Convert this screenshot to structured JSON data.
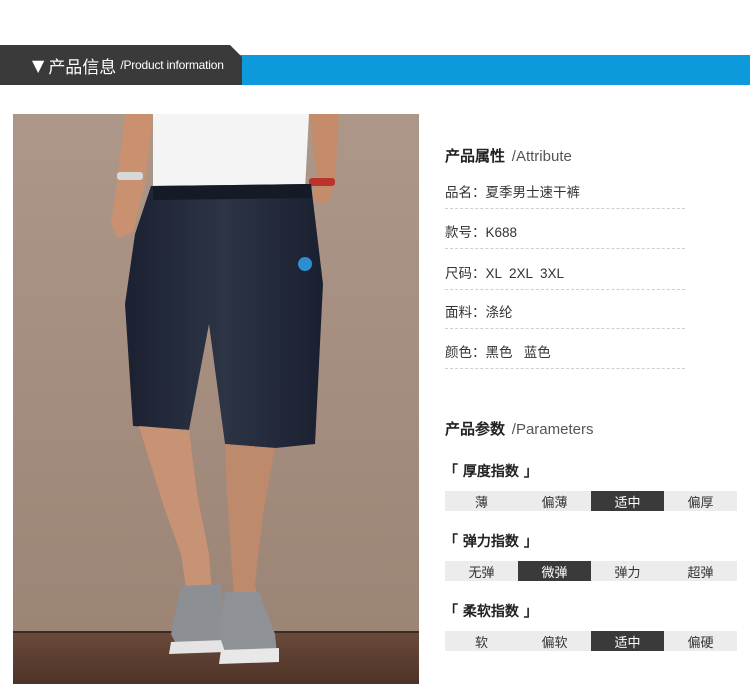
{
  "header": {
    "arrow": "▼",
    "title_zh": "产品信息",
    "title_en": "/Product information"
  },
  "colors": {
    "header_blue": "#0d99dc",
    "header_dark": "#3a3a3a",
    "selected_segment": "#3a3a3a",
    "scale_background": "#ececec"
  },
  "attributes": {
    "title_zh": "产品属性",
    "title_en": "/Attribute",
    "rows": [
      {
        "label": "品名：",
        "value": "夏季男士速干裤"
      },
      {
        "label": "款号：",
        "value": "K688"
      },
      {
        "label": "尺码：",
        "value": "XL  2XL  3XL"
      },
      {
        "label": "面料：",
        "value": "涤纶"
      },
      {
        "label": "颜色：",
        "value": "黑色   蓝色"
      }
    ]
  },
  "parameters": {
    "title_zh": "产品参数",
    "title_en": "/Parameters",
    "indices": [
      {
        "title": "「 厚度指数 」",
        "options": [
          "薄",
          "偏薄",
          "适中",
          "偏厚"
        ],
        "selected": 2
      },
      {
        "title": "「 弹力指数 」",
        "options": [
          "无弹",
          "微弹",
          "弹力",
          "超弹"
        ],
        "selected": 1
      },
      {
        "title": "「 柔软指数 」",
        "options": [
          "软",
          "偏软",
          "适中",
          "偏硬"
        ],
        "selected": 2
      }
    ]
  }
}
